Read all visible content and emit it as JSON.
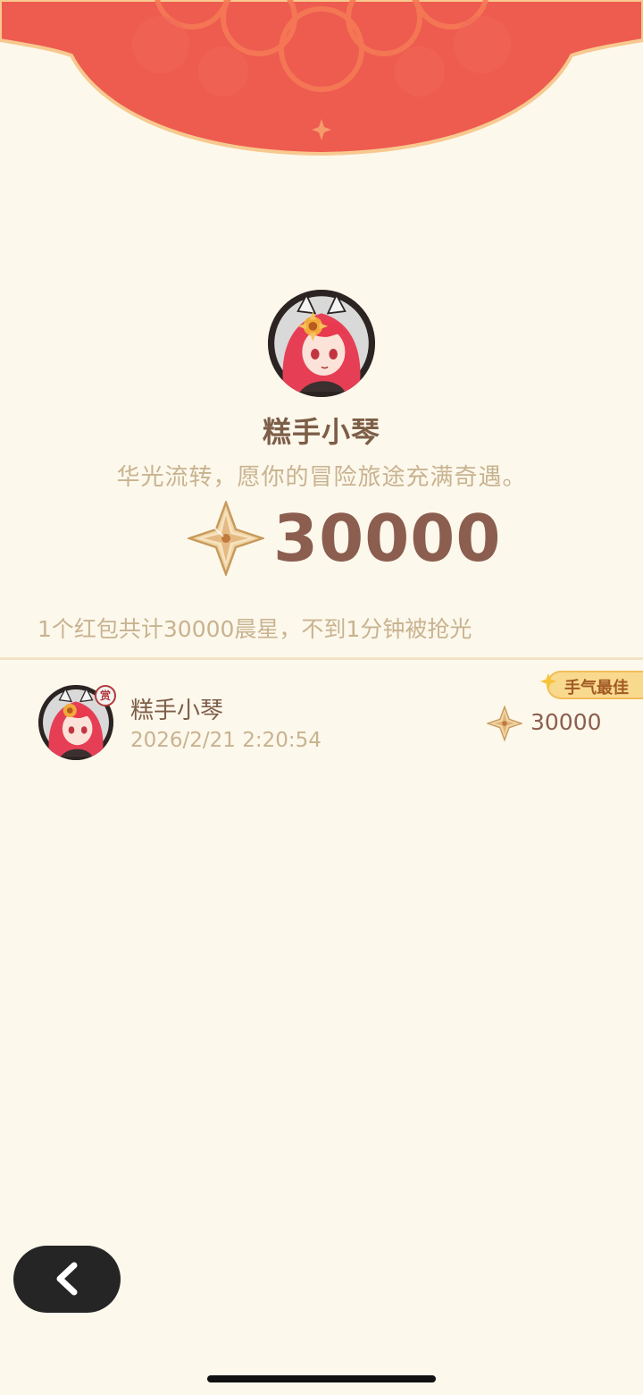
{
  "sender": {
    "name": "糕手小琴",
    "greeting": "华光流转，愿你的冒险旅途充满奇遇。",
    "amount": "30000",
    "currency_icon": "starglitter-gem-icon"
  },
  "summary": "1个红包共计30000晨星，不到1分钟被抢光",
  "records": [
    {
      "name": "糕手小琴",
      "time": "2026/2/21 2:20:54",
      "amount": "30000",
      "badge": "手气最佳",
      "avatar_badge": "赏"
    }
  ],
  "navigation": {
    "back_icon": "chevron-left-icon"
  },
  "colors": {
    "background": "#fdf8ec",
    "header_red": "#ee5b4f",
    "amount_brown": "#8b5e4f",
    "name_brown": "#7d5e48",
    "muted_text": "#c8b390",
    "best_badge": "#f9d98e"
  }
}
